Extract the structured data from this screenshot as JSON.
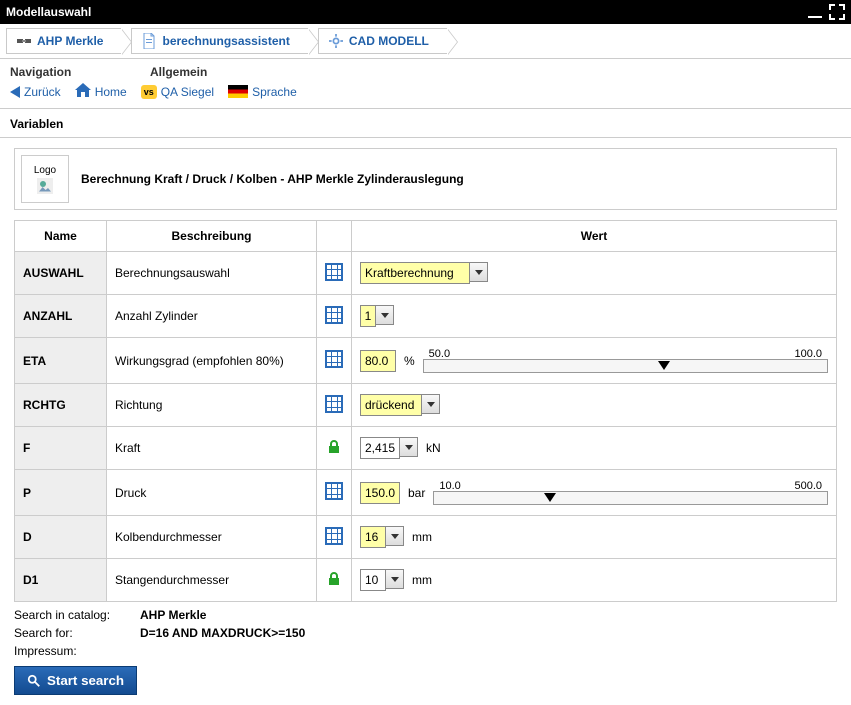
{
  "window": {
    "title": "Modellauswahl"
  },
  "breadcrumbs": {
    "items": [
      "AHP Merkle",
      "berechnungsassistent",
      "CAD MODELL"
    ]
  },
  "sections": {
    "navigation": "Navigation",
    "allgemein": "Allgemein",
    "variablen": "Variablen"
  },
  "toolbar": {
    "back": "Zurück",
    "home": "Home",
    "qa": "QA Siegel",
    "lang": "Sprache"
  },
  "header": {
    "logo_text": "Logo",
    "title": "Berechnung Kraft / Druck / Kolben - AHP Merkle Zylinderauslegung"
  },
  "table": {
    "col_name": "Name",
    "col_desc": "Beschreibung",
    "col_value": "Wert",
    "rows": {
      "auswahl": {
        "name": "AUSWAHL",
        "desc": "Berechnungsauswahl",
        "value": "Kraftberechnung"
      },
      "anzahl": {
        "name": "ANZAHL",
        "desc": "Anzahl Zylinder",
        "value": "1"
      },
      "eta": {
        "name": "ETA",
        "desc": "Wirkungsgrad (empfohlen 80%)",
        "value": "80.0",
        "unit": "%",
        "min": "50.0",
        "max": "100.0"
      },
      "rchtg": {
        "name": "RCHTG",
        "desc": "Richtung",
        "value": "drückend"
      },
      "f": {
        "name": "F",
        "desc": "Kraft",
        "value": "2,415",
        "unit": "kN"
      },
      "p": {
        "name": "P",
        "desc": "Druck",
        "value": "150.0",
        "unit": "bar",
        "min": "10.0",
        "max": "500.0"
      },
      "d": {
        "name": "D",
        "desc": "Kolbendurchmesser",
        "value": "16",
        "unit": "mm"
      },
      "d1": {
        "name": "D1",
        "desc": "Stangendurchmesser",
        "value": "10",
        "unit": "mm"
      }
    }
  },
  "footer": {
    "search_catalog_label": "Search in catalog:",
    "search_catalog_value": "AHP Merkle",
    "search_for_label": "Search for:",
    "search_for_value": "D=16 AND MAXDRUCK>=150",
    "impressum": "Impressum:",
    "start_button": "Start search"
  }
}
